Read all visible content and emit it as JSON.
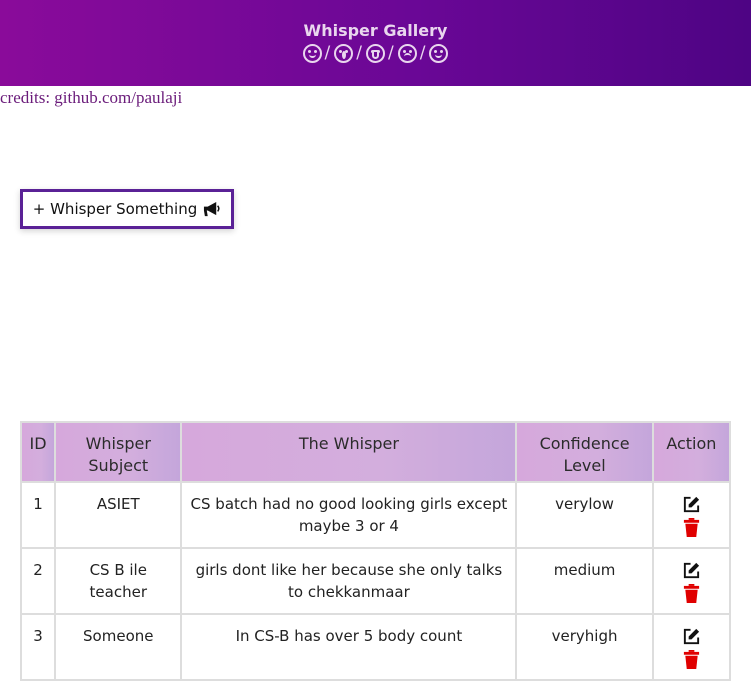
{
  "header": {
    "title": "Whisper Gallery",
    "emojis": [
      "laughing-emoji",
      "surprised-emoji",
      "scream-emoji",
      "crying-emoji",
      "wink-emoji"
    ],
    "separator": "/"
  },
  "credits": {
    "prefix": "credits: ",
    "link_text": "github.com/paulaji"
  },
  "whisper_button": {
    "label": "+ Whisper Something",
    "icon": "megaphone-icon",
    "border_color": "#5a2196"
  },
  "table": {
    "columns": [
      "ID",
      "Whisper Subject",
      "The Whisper",
      "Confidence Level",
      "Action"
    ],
    "rows": [
      {
        "id": "1",
        "subject": "ASIET",
        "whisper": "CS batch had no good looking girls except maybe 3 or 4",
        "confidence": "verylow"
      },
      {
        "id": "2",
        "subject": "CS B ile teacher",
        "whisper": "girls dont like her because she only talks to chekkanmaar",
        "confidence": "medium"
      },
      {
        "id": "3",
        "subject": "Someone",
        "whisper": "In CS-B has over 5 body count",
        "confidence": "veryhigh"
      }
    ],
    "actions": {
      "edit_icon": "edit-icon",
      "delete_icon": "trash-icon",
      "delete_color": "#e00000"
    }
  },
  "colors": {
    "header_gradient_start": "#8a0b9a",
    "header_gradient_end": "#4e0484",
    "table_header": "#d6a8dc"
  }
}
